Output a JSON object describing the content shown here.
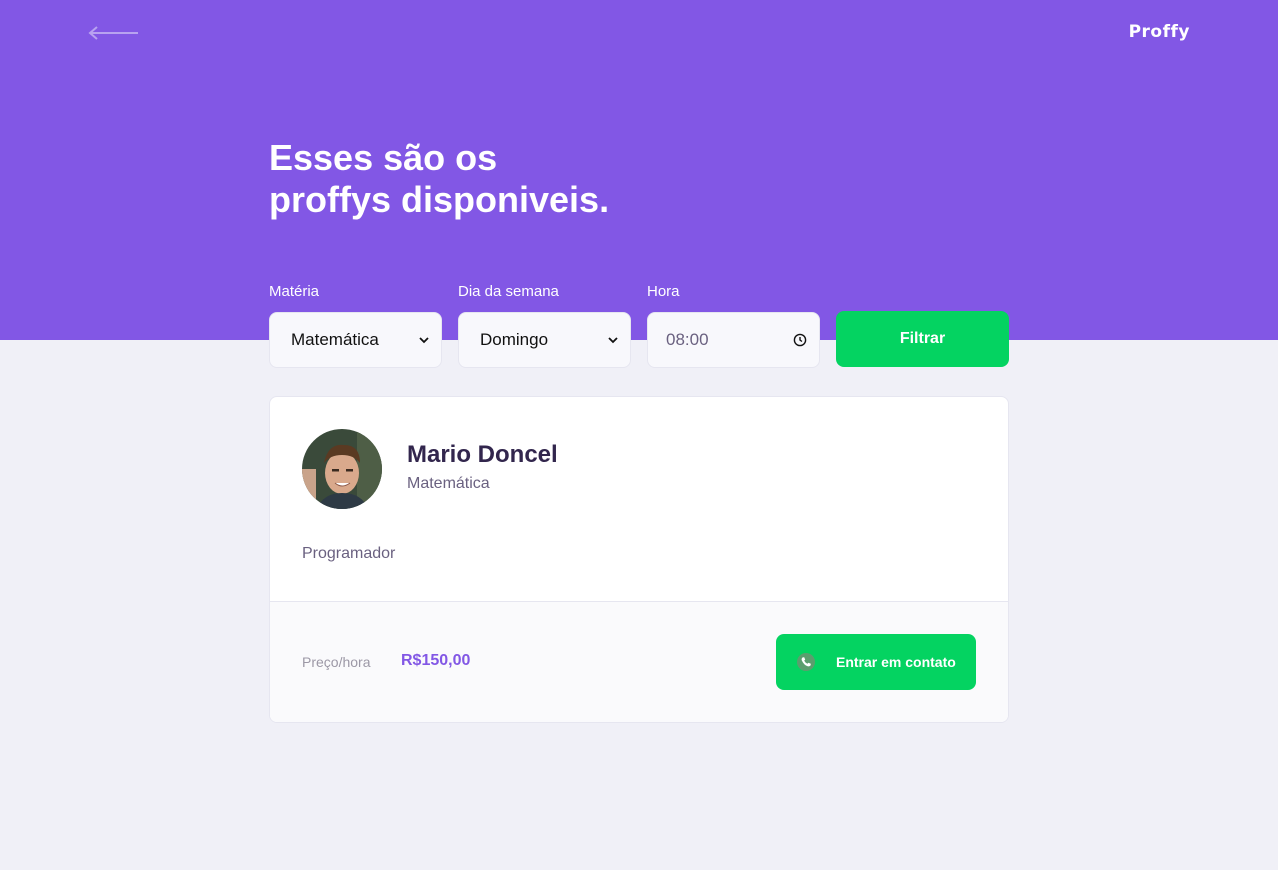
{
  "header": {
    "back_icon": "arrow-left-icon",
    "logo": "Proffy"
  },
  "page": {
    "title_line1": "Esses são os",
    "title_line2": "proffys disponiveis."
  },
  "filters": {
    "subject": {
      "label": "Matéria",
      "value": "Matemática"
    },
    "weekday": {
      "label": "Dia da semana",
      "value": "Domingo"
    },
    "time": {
      "label": "Hora",
      "value": "08:00",
      "icon": "clock-icon"
    },
    "submit_label": "Filtrar"
  },
  "teachers": [
    {
      "name": "Mario Doncel",
      "subject": "Matemática",
      "bio": "Programador",
      "price_label": "Preço/hora",
      "price": "R$150,00",
      "contact_label": "Entrar em contato",
      "contact_icon": "whatsapp-icon"
    }
  ],
  "colors": {
    "primary": "#8257E5",
    "secondary": "#04D361",
    "background": "#F0F0F7",
    "title_dark": "#32264D",
    "text_muted": "#6A6180"
  }
}
